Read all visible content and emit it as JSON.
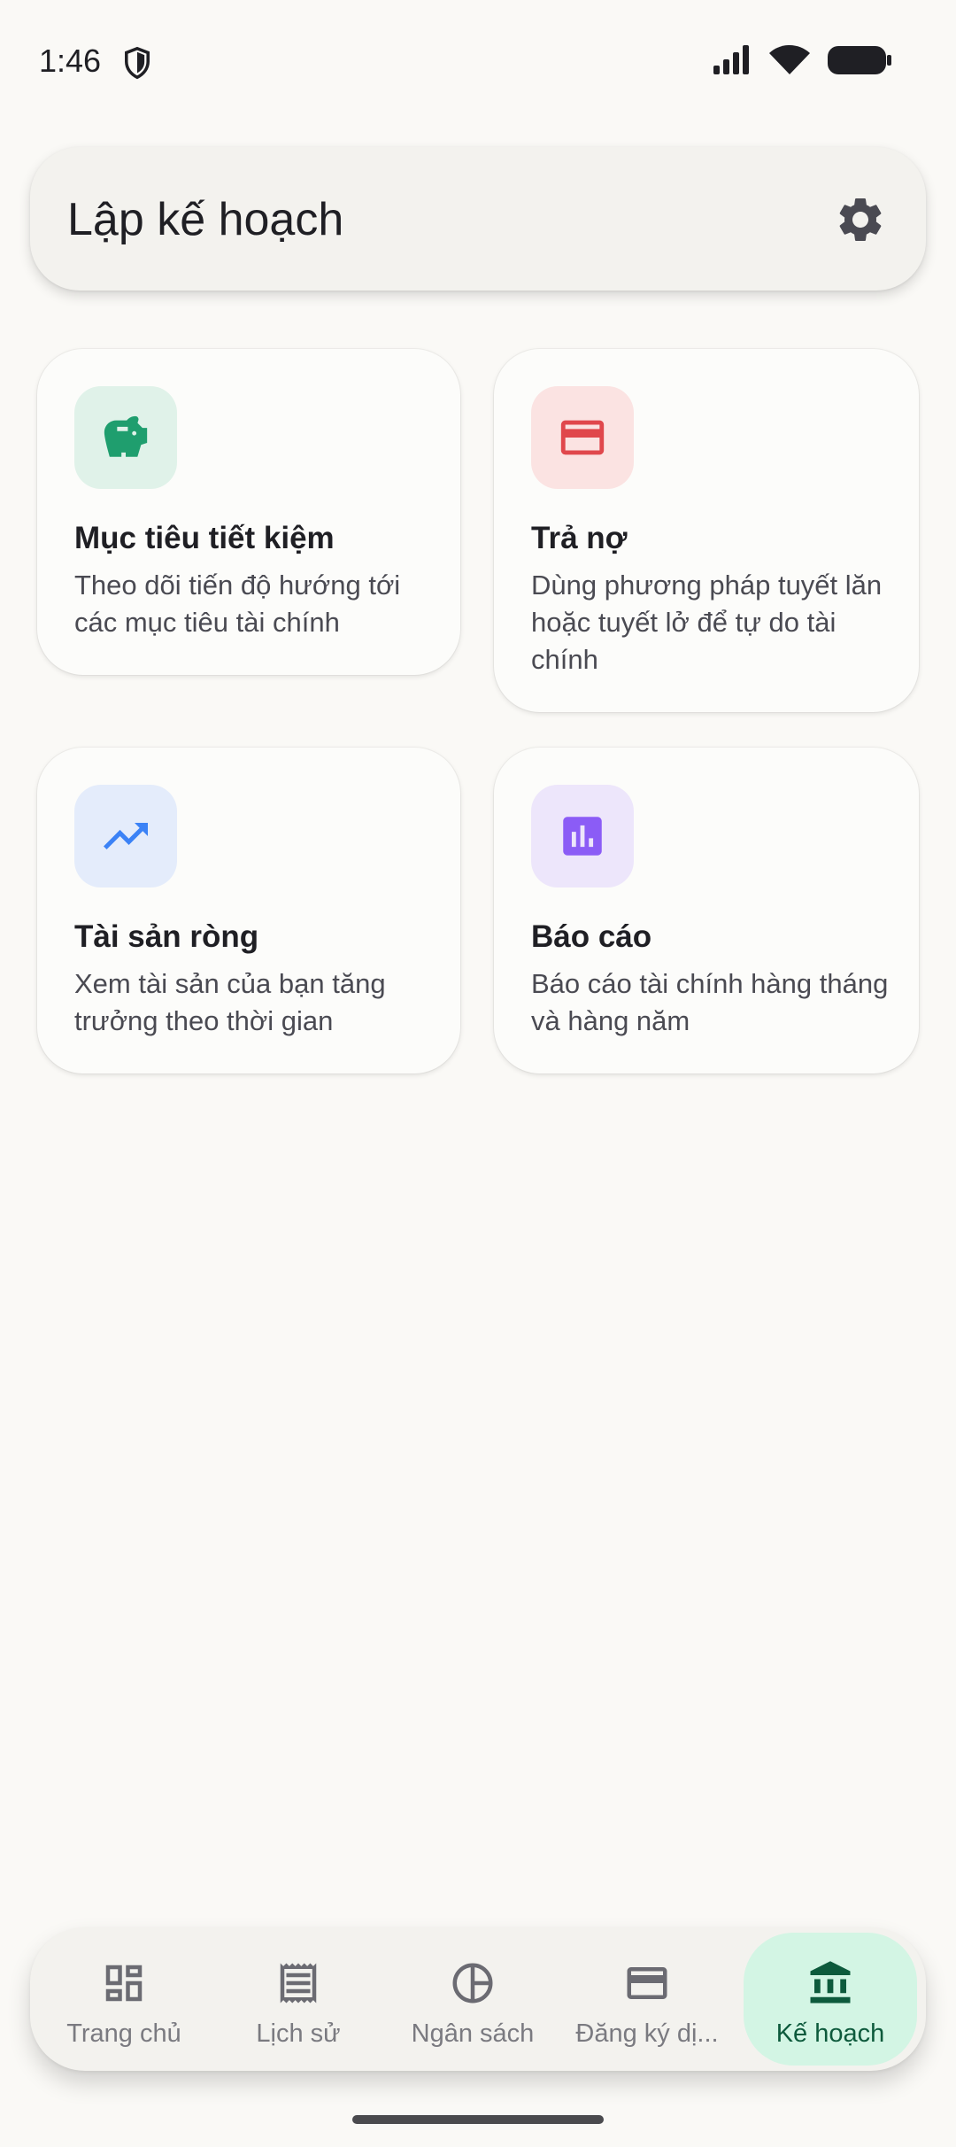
{
  "status": {
    "time": "1:46"
  },
  "header": {
    "title": "Lập kế hoạch"
  },
  "cards": [
    {
      "title": "Mục tiêu tiết kiệm",
      "description": "Theo dõi tiến độ hướng tới các mục tiêu tài chính",
      "icon": "piggy-bank-icon",
      "icon_color": "#1f9e6e",
      "icon_bg": "#e0f2e9"
    },
    {
      "title": "Trả nợ",
      "description": "Dùng phương pháp tuyết lăn hoặc tuyết lở để tự do tài chính",
      "icon": "credit-card-icon",
      "icon_color": "#e0474c",
      "icon_bg": "#fbe3e2"
    },
    {
      "title": "Tài sản ròng",
      "description": "Xem tài sản của bạn tăng trưởng theo thời gian",
      "icon": "trending-up-icon",
      "icon_color": "#3b82f6",
      "icon_bg": "#e4ecfb"
    },
    {
      "title": "Báo cáo",
      "description": "Báo cáo tài chính hàng tháng và hàng năm",
      "icon": "bar-chart-icon",
      "icon_color": "#8b5cf6",
      "icon_bg": "#ede6fb"
    }
  ],
  "nav": {
    "items": [
      {
        "label": "Trang chủ",
        "icon": "dashboard-icon"
      },
      {
        "label": "Lịch sử",
        "icon": "receipt-icon"
      },
      {
        "label": "Ngân sách",
        "icon": "pie-chart-icon"
      },
      {
        "label": "Đăng ký dị...",
        "icon": "credit-card-icon"
      },
      {
        "label": "Kế hoạch",
        "icon": "bank-icon",
        "active": true
      }
    ]
  },
  "colors": {
    "accent": "#0d5a3c",
    "active_bg": "#d3f5e4",
    "background": "#faf9f6"
  }
}
